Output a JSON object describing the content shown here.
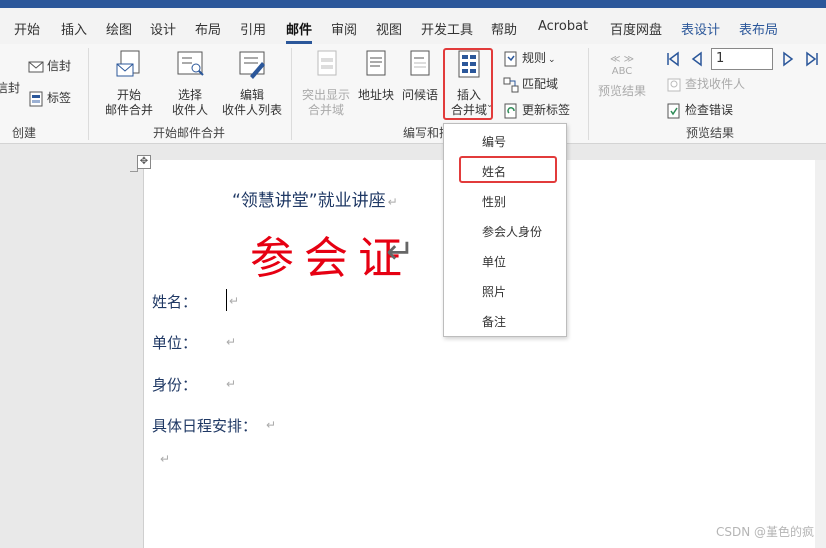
{
  "tabs": [
    {
      "label": "开始"
    },
    {
      "label": "插入"
    },
    {
      "label": "绘图"
    },
    {
      "label": "设计"
    },
    {
      "label": "布局"
    },
    {
      "label": "引用"
    },
    {
      "label": "邮件"
    },
    {
      "label": "审阅"
    },
    {
      "label": "视图"
    },
    {
      "label": "开发工具"
    },
    {
      "label": "帮助"
    },
    {
      "label": "Acrobat"
    },
    {
      "label": "百度网盘"
    },
    {
      "label": "表设计"
    },
    {
      "label": "表布局"
    }
  ],
  "ribbon": {
    "create": {
      "envelope_label": "信封",
      "envelope_cut_label": "信封",
      "labels_label": "标签",
      "group_label": "创建"
    },
    "start_merge": {
      "start_label_1": "开始",
      "start_label_2": "邮件合并",
      "select_label_1": "选择",
      "select_label_2": "收件人",
      "edit_label_1": "编辑",
      "edit_label_2": "收件人列表",
      "group_label": "开始邮件合并"
    },
    "write_insert": {
      "highlight_label_1": "突出显示",
      "highlight_label_2": "合并域",
      "address_label": "地址块",
      "greeting_label": "问候语",
      "insert_label_1": "插入",
      "insert_label_2": "合并域",
      "rules_label": "规则",
      "match_label": "匹配域",
      "update_label": "更新标签",
      "group_label": "编写和插"
    },
    "preview": {
      "preview_label": "预览结果",
      "abc_label": "ABC",
      "record_value": "1",
      "find_label": "查找收件人",
      "check_label": "检查错误",
      "group_label": "预览结果"
    }
  },
  "dropdown": {
    "items": [
      "编号",
      "姓名",
      "性别",
      "参会人身份",
      "单位",
      "照片",
      "备注"
    ]
  },
  "document": {
    "title": "“领慧讲堂”就业讲座",
    "big_title": "参会证",
    "fields": [
      "姓名：",
      "单位：",
      "身份：",
      "具体日程安排："
    ],
    "para_mark": "↵"
  },
  "watermark": "CSDN @堇色的疯",
  "colors": {
    "accent": "#2b579a",
    "highlight_box": "#e23b3b",
    "title_red": "#e60012",
    "doc_text": "#1f3864"
  }
}
